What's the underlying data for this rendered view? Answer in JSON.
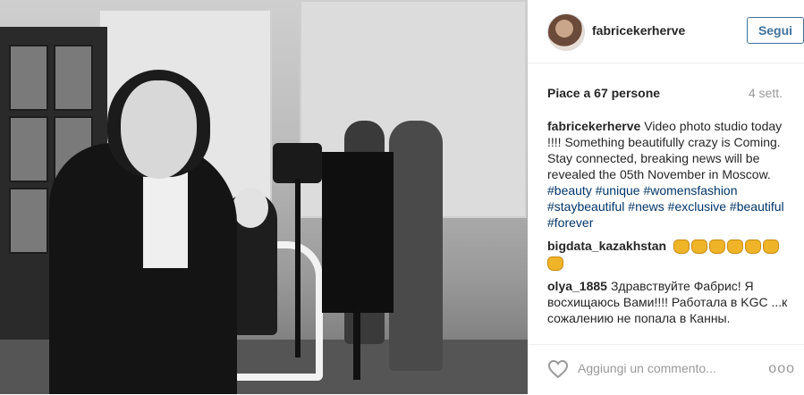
{
  "post": {
    "username": "fabricekerherve",
    "follow_label": "Segui",
    "likes": "Piace a 67 persone",
    "time": "4 sett."
  },
  "comments": [
    {
      "user": "fabricekerherve",
      "text": "Video photo studio today !!!! Something beautifully crazy is Coming. Stay connected, breaking news will be revealed the 05th November in Moscow.",
      "hashtags": [
        "#beauty",
        "#unique",
        "#womensfashion",
        "#staybeautiful",
        "#news",
        "#exclusive",
        "#beautiful",
        "#forever"
      ]
    },
    {
      "user": "bigdata_kazakhstan",
      "emoji_count": 7,
      "emoji_name": "clapping-hands"
    },
    {
      "user": "olya_1885",
      "text": "Здравствуйте Фабрис! Я восхищаюсь Вами!!!! Работала в KGC ...к сожалению не попала в Канны."
    }
  ],
  "footer": {
    "placeholder": "Aggiungi un commento...",
    "more": "ooo"
  },
  "icons": {
    "heart": "heart-icon",
    "more": "more-options-icon"
  }
}
